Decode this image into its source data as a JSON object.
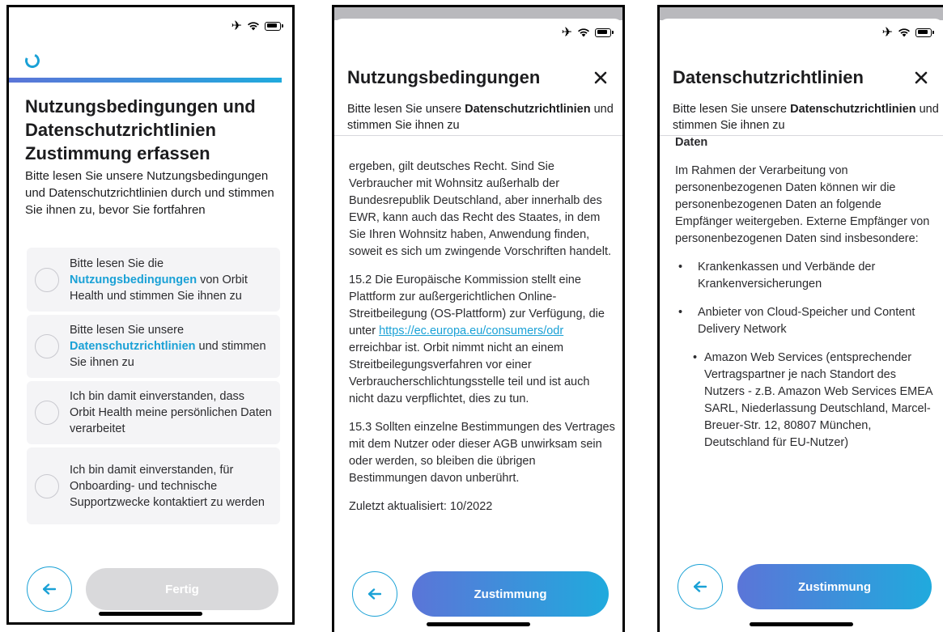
{
  "consent_screen": {
    "title": "Nutzungsbedingungen und Datenschutzrichtlinien Zustimmung erfassen",
    "description": "Bitte lesen Sie unsere Nutzungsbedingungen und Datenschutzrichtlinien durch und stimmen Sie ihnen zu, bevor Sie fortfahren",
    "progress_percent": 100,
    "cards": [
      {
        "pre": "Bitte lesen Sie die ",
        "link": "Nutzungsbedingungen",
        "post": " von Orbit Health und stimmen Sie ihnen zu"
      },
      {
        "pre": "Bitte lesen Sie unsere ",
        "link": "Datenschutzrichtlinien",
        "post": " und stimmen Sie ihnen zu"
      },
      {
        "pre": "Ich bin damit einverstanden, dass Orbit Health meine persönlichen Daten verarbeitet",
        "link": "",
        "post": ""
      },
      {
        "pre": "Ich bin damit einverstanden, für Onboarding- und technische Supportzwecke kontaktiert zu werden",
        "link": "",
        "post": ""
      }
    ],
    "done_label": "Fertig"
  },
  "terms_modal": {
    "title": "Nutzungsbedingungen",
    "subtitle_pre": "Bitte lesen Sie unsere ",
    "subtitle_bold": "Datenschutzrichtlinien",
    "subtitle_post": " und stimmen Sie ihnen zu",
    "para1": "ergeben, gilt deutsches Recht. Sind Sie Verbraucher mit Wohnsitz außerhalb der Bundesrepublik Deutschland, aber innerhalb des EWR, kann auch das Recht des Staates, in dem Sie Ihren Wohnsitz haben, Anwendung finden, soweit es sich um zwingende Vorschriften handelt.",
    "para2_pre": "15.2 Die Europäische Kommission stellt eine Plattform zur außergerichtlichen Online-Streitbeilegung (OS-Plattform) zur Verfügung, die unter ",
    "para2_link": "https://ec.europa.eu/consumers/odr",
    "para2_post": " erreichbar ist. Orbit nimmt nicht an einem Streitbeilegungsverfahren vor einer Verbraucherschlichtungsstelle teil und ist auch nicht dazu verpflichtet, dies zu tun.",
    "para3": "15.3 Sollten einzelne Bestimmungen des Vertrages mit dem Nutzer oder dieser AGB unwirksam sein oder werden, so bleiben die übrigen Bestimmungen davon unberührt.",
    "updated": "Zuletzt aktualisiert: 10/2022",
    "agree_label": "Zustimmung"
  },
  "privacy_modal": {
    "title": "Datenschutzrichtlinien",
    "subtitle_pre": "Bitte lesen Sie unsere ",
    "subtitle_bold": "Datenschutzrichtlinien",
    "subtitle_post": " und stimmen Sie ihnen zu",
    "cut_heading": "Daten",
    "para1": "Im Rahmen der Verarbeitung von personenbezogenen Daten können wir die personenbezogenen Daten an folgende Empfänger weitergeben. Externe Empfänger von personenbezogenen Daten sind insbesondere:",
    "bullet1": "Krankenkassen und Verbände der Krankenversicherungen",
    "bullet2": "Anbieter von Cloud-Speicher und Content Delivery Network",
    "sub_bullet": "Amazon Web Services (entsprechender Vertragspartner je nach Standort des Nutzers - z.B. Amazon Web Services EMEA SARL, Niederlassung Deutschland, Marcel-Breuer-Str. 12, 80807 München, Deutschland für EU-Nutzer)",
    "agree_label": "Zustimmung"
  },
  "icons": {
    "back": "arrow-left-icon",
    "close": "close-icon",
    "status": [
      "airplane-icon",
      "wifi-icon",
      "battery-charging-icon"
    ]
  },
  "colors": {
    "accent": "#1aa1d6",
    "gradient_start": "#5b75d8",
    "gradient_end": "#20aadd",
    "card_bg": "#f4f4f6",
    "disabled": "#d9d9db"
  }
}
